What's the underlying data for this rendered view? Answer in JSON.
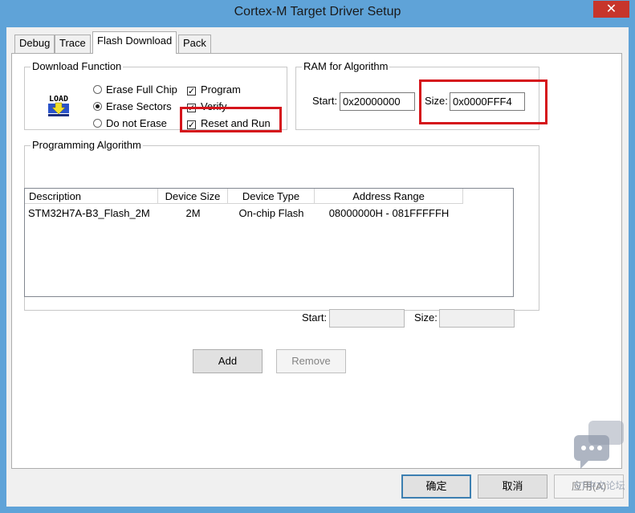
{
  "window": {
    "title": "Cortex-M Target Driver Setup",
    "close_glyph": "✕"
  },
  "tabs": [
    {
      "label": "Debug"
    },
    {
      "label": "Trace"
    },
    {
      "label": "Flash Download"
    },
    {
      "label": "Pack"
    }
  ],
  "download_function": {
    "legend": "Download Function",
    "icon_label": "LOAD",
    "radios": [
      {
        "label": "Erase Full Chip",
        "checked": false
      },
      {
        "label": "Erase Sectors",
        "checked": true
      },
      {
        "label": "Do not Erase",
        "checked": false
      }
    ],
    "checks": [
      {
        "label": "Program",
        "checked": true
      },
      {
        "label": "Verify",
        "checked": true
      },
      {
        "label": "Reset and Run",
        "checked": true
      }
    ]
  },
  "ram": {
    "legend": "RAM for Algorithm",
    "start_label": "Start:",
    "start_value": "0x20000000",
    "size_label": "Size:",
    "size_value": "0x0000FFF4"
  },
  "programming": {
    "legend": "Programming Algorithm",
    "columns": [
      "Description",
      "Device Size",
      "Device Type",
      "Address Range"
    ],
    "rows": [
      {
        "description": "STM32H7A-B3_Flash_2M",
        "device_size": "2M",
        "device_type": "On-chip Flash",
        "address_range": "08000000H - 081FFFFFH"
      }
    ],
    "start_label": "Start:",
    "size_label": "Size:"
  },
  "buttons": {
    "add": "Add",
    "remove": "Remove"
  },
  "footer": {
    "ok": "确定",
    "cancel": "取消",
    "apply": "应用(A)"
  },
  "watermark": {
    "text": "ST中文论坛"
  },
  "colors": {
    "highlight": "#d5141b",
    "titlebar": "#5fa3d8",
    "close": "#c7352b"
  }
}
